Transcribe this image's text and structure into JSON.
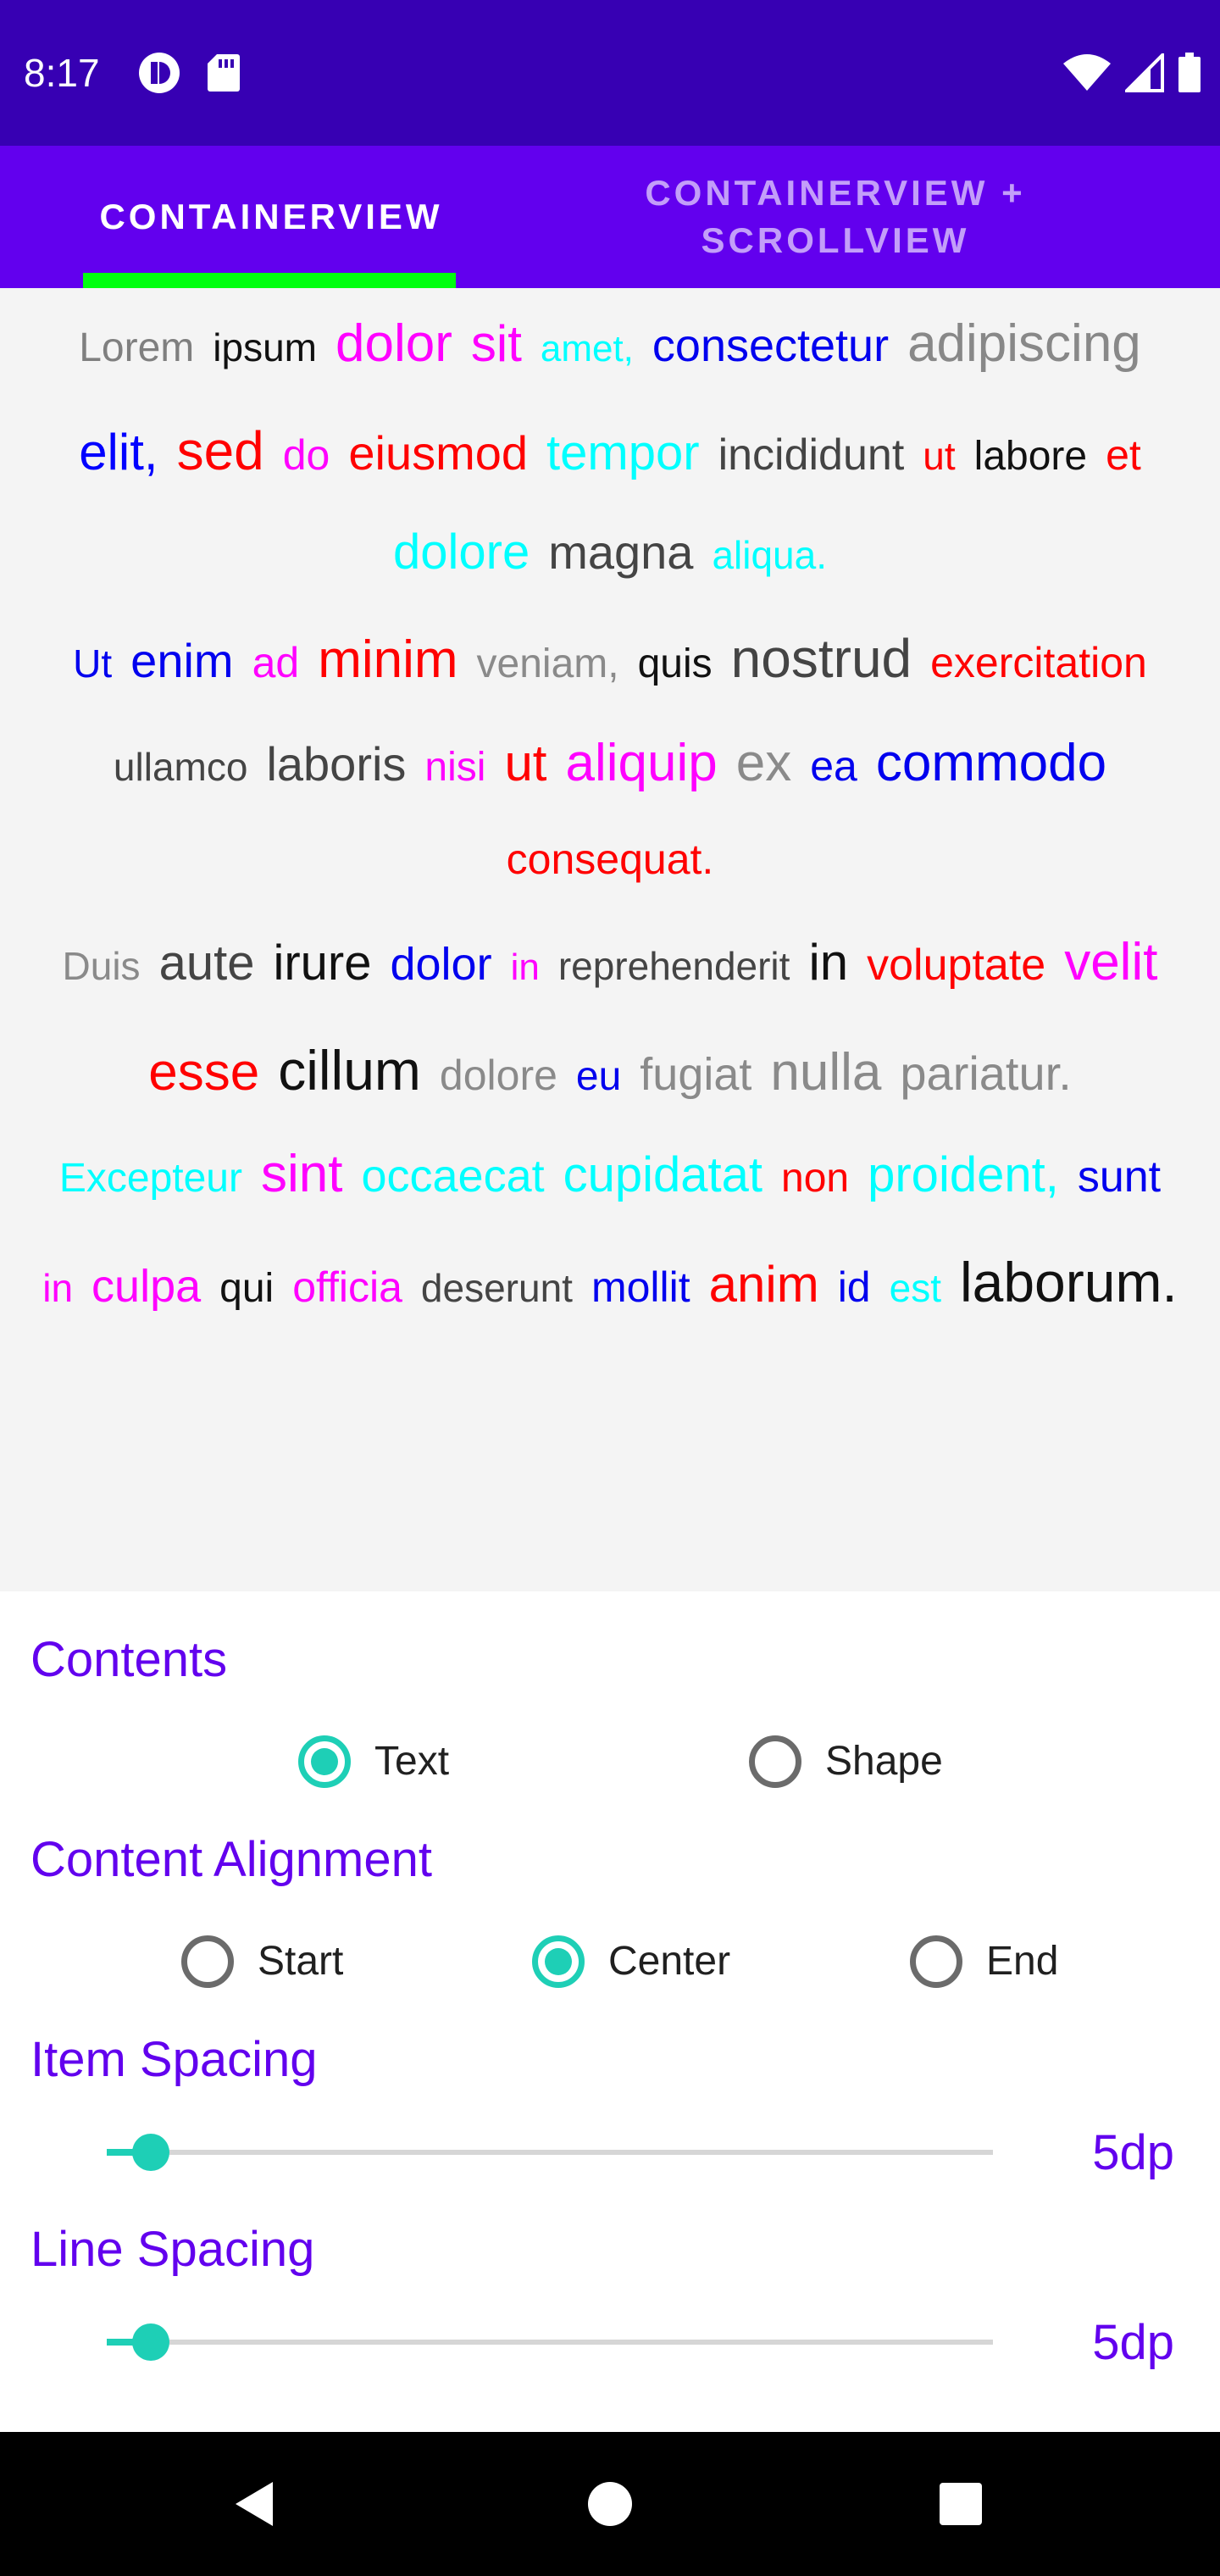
{
  "status_bar": {
    "time": "8:17",
    "left_icons": [
      "notification-app-icon",
      "sd-card-icon"
    ],
    "right_icons": [
      "wifi-icon",
      "cellular-signal-icon",
      "battery-icon"
    ],
    "background": "#3700b3"
  },
  "tabs": [
    {
      "label": "CONTAINERVIEW",
      "selected": true
    },
    {
      "label": "CONTAINERVIEW + SCROLLVIEW",
      "selected": false
    }
  ],
  "tab_indicator_color": "#00ff0f",
  "flow_text": {
    "lines": [
      [
        {
          "t": "Lorem",
          "c": "#7f7f7f",
          "s": 48
        },
        {
          "t": "ipsum",
          "c": "#111111",
          "s": 46
        },
        {
          "t": "dolor",
          "c": "#ff00ff",
          "s": 62
        },
        {
          "t": "sit",
          "c": "#ff00ff",
          "s": 60
        },
        {
          "t": "amet,",
          "c": "#00ffff",
          "s": 44
        },
        {
          "t": "consectetur",
          "c": "#0000ee",
          "s": 54
        },
        {
          "t": "adipiscing",
          "c": "#888888",
          "s": 62
        }
      ],
      [
        {
          "t": "elit,",
          "c": "#0000ff",
          "s": 60
        },
        {
          "t": "sed",
          "c": "#ff0000",
          "s": 64
        },
        {
          "t": "do",
          "c": "#ff00ff",
          "s": 50
        },
        {
          "t": "eiusmod",
          "c": "#ff0000",
          "s": 56
        },
        {
          "t": "tempor",
          "c": "#00ffff",
          "s": 58
        },
        {
          "t": "incididunt",
          "c": "#444444",
          "s": 52
        },
        {
          "t": "ut",
          "c": "#ff0000",
          "s": 46
        },
        {
          "t": "labore",
          "c": "#111111",
          "s": 48
        },
        {
          "t": "et",
          "c": "#ff0000",
          "s": 50
        }
      ],
      [
        {
          "t": "dolore",
          "c": "#00ffff",
          "s": 58
        },
        {
          "t": "magna",
          "c": "#444444",
          "s": 56
        },
        {
          "t": "aliqua.",
          "c": "#00ffff",
          "s": 46
        }
      ],
      [
        {
          "t": "Ut",
          "c": "#0000ee",
          "s": 46
        },
        {
          "t": "enim",
          "c": "#0000ee",
          "s": 56
        },
        {
          "t": "ad",
          "c": "#ff00ff",
          "s": 50
        },
        {
          "t": "minim",
          "c": "#ff0000",
          "s": 62
        },
        {
          "t": "veniam,",
          "c": "#8a8a8a",
          "s": 48
        },
        {
          "t": "quis",
          "c": "#111111",
          "s": 48
        },
        {
          "t": "nostrud",
          "c": "#444444",
          "s": 64
        },
        {
          "t": "exercitation",
          "c": "#ff0000",
          "s": 50
        }
      ],
      [
        {
          "t": "ullamco",
          "c": "#444444",
          "s": 46
        },
        {
          "t": "laboris",
          "c": "#444444",
          "s": 56
        },
        {
          "t": "nisi",
          "c": "#ff00ff",
          "s": 48
        },
        {
          "t": "ut",
          "c": "#ff0000",
          "s": 60
        },
        {
          "t": "aliquip",
          "c": "#ff00ff",
          "s": 62
        },
        {
          "t": "ex",
          "c": "#8a8a8a",
          "s": 62
        },
        {
          "t": "ea",
          "c": "#0000ee",
          "s": 50
        },
        {
          "t": "commodo",
          "c": "#0000ee",
          "s": 62
        }
      ],
      [
        {
          "t": "consequat.",
          "c": "#ff0000",
          "s": 50
        }
      ],
      [
        {
          "t": "Duis",
          "c": "#8a8a8a",
          "s": 46
        },
        {
          "t": "aute",
          "c": "#444444",
          "s": 58
        },
        {
          "t": "irure",
          "c": "#111111",
          "s": 58
        },
        {
          "t": "dolor",
          "c": "#0000ee",
          "s": 54
        },
        {
          "t": "in",
          "c": "#ff00ff",
          "s": 44
        },
        {
          "t": "reprehenderit",
          "c": "#444444",
          "s": 46
        },
        {
          "t": "in",
          "c": "#111111",
          "s": 60
        },
        {
          "t": "voluptate",
          "c": "#ff0000",
          "s": 52
        },
        {
          "t": "velit",
          "c": "#ff00ff",
          "s": 62
        }
      ],
      [
        {
          "t": "esse",
          "c": "#ff0000",
          "s": 62
        },
        {
          "t": "cillum",
          "c": "#111111",
          "s": 66
        },
        {
          "t": "dolore",
          "c": "#8a8a8a",
          "s": 50
        },
        {
          "t": "eu",
          "c": "#0000ee",
          "s": 48
        },
        {
          "t": "fugiat",
          "c": "#8a8a8a",
          "s": 54
        },
        {
          "t": "nulla",
          "c": "#8a8a8a",
          "s": 62
        },
        {
          "t": "pariatur.",
          "c": "#8a8a8a",
          "s": 56
        }
      ],
      [
        {
          "t": "Excepteur",
          "c": "#00ffff",
          "s": 48
        },
        {
          "t": "sint",
          "c": "#ff00ff",
          "s": 62
        },
        {
          "t": "occaecat",
          "c": "#00ffff",
          "s": 54
        },
        {
          "t": "cupidatat",
          "c": "#00ffff",
          "s": 58
        },
        {
          "t": "non",
          "c": "#ff0000",
          "s": 48
        },
        {
          "t": "proident,",
          "c": "#00ffff",
          "s": 58
        },
        {
          "t": "sunt",
          "c": "#0000ee",
          "s": 52
        }
      ],
      [
        {
          "t": "in",
          "c": "#ff00ff",
          "s": 46
        },
        {
          "t": "culpa",
          "c": "#ff00ff",
          "s": 54
        },
        {
          "t": "qui",
          "c": "#111111",
          "s": 48
        },
        {
          "t": "officia",
          "c": "#ff00ff",
          "s": 50
        },
        {
          "t": "deserunt",
          "c": "#444444",
          "s": 46
        },
        {
          "t": "mollit",
          "c": "#0000ee",
          "s": 50
        },
        {
          "t": "anim",
          "c": "#ff0000",
          "s": 60
        },
        {
          "t": "id",
          "c": "#0000ee",
          "s": 50
        },
        {
          "t": "est",
          "c": "#00ffff",
          "s": 46
        },
        {
          "t": "laborum.",
          "c": "#111111",
          "s": 66
        }
      ]
    ]
  },
  "controls": {
    "contents": {
      "label": "Contents",
      "options": [
        {
          "label": "Text",
          "checked": true
        },
        {
          "label": "Shape",
          "checked": false
        }
      ]
    },
    "alignment": {
      "label": "Content Alignment",
      "options": [
        {
          "label": "Start",
          "checked": false
        },
        {
          "label": "Center",
          "checked": true
        },
        {
          "label": "End",
          "checked": false
        }
      ]
    },
    "item_spacing": {
      "label": "Item Spacing",
      "value_text": "5dp",
      "fraction": 0.05
    },
    "line_spacing": {
      "label": "Line Spacing",
      "value_text": "5dp",
      "fraction": 0.05
    }
  },
  "accent_color": "#1ecfb6",
  "nav_bar": {
    "buttons": [
      "back-icon",
      "home-icon",
      "recents-icon"
    ]
  }
}
